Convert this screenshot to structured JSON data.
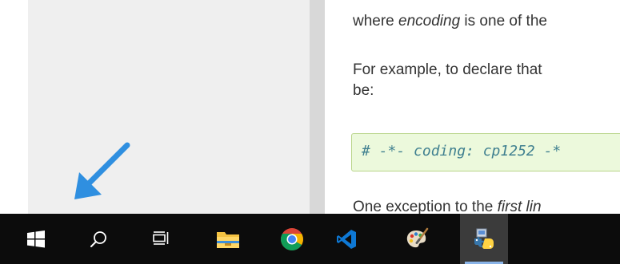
{
  "document": {
    "line1_prefix": "where ",
    "line1_em": "encoding",
    "line1_suffix": " is one of the",
    "line2": "For example, to declare that",
    "line3": "be:",
    "code": "# -*- coding: cp1252 -*",
    "line4_prefix": "One exception to the ",
    "line4_em": "first lin"
  },
  "colors": {
    "sidebar_bg": "#efefef",
    "code_bg": "#ecf9dc",
    "code_text": "#408090",
    "taskbar_bg": "#0c0c0c",
    "arrow": "#2f8fe0"
  },
  "taskbar": {
    "items": [
      {
        "name": "start",
        "icon": "windows-logo-icon"
      },
      {
        "name": "search",
        "icon": "search-icon"
      },
      {
        "name": "task-view",
        "icon": "task-view-icon"
      },
      {
        "name": "file-explorer",
        "icon": "folder-icon"
      },
      {
        "name": "chrome",
        "icon": "chrome-icon"
      },
      {
        "name": "vscode",
        "icon": "vscode-icon"
      },
      {
        "name": "paint",
        "icon": "paint-palette-icon"
      },
      {
        "name": "python-idle",
        "icon": "python-icon",
        "active": true
      }
    ]
  }
}
